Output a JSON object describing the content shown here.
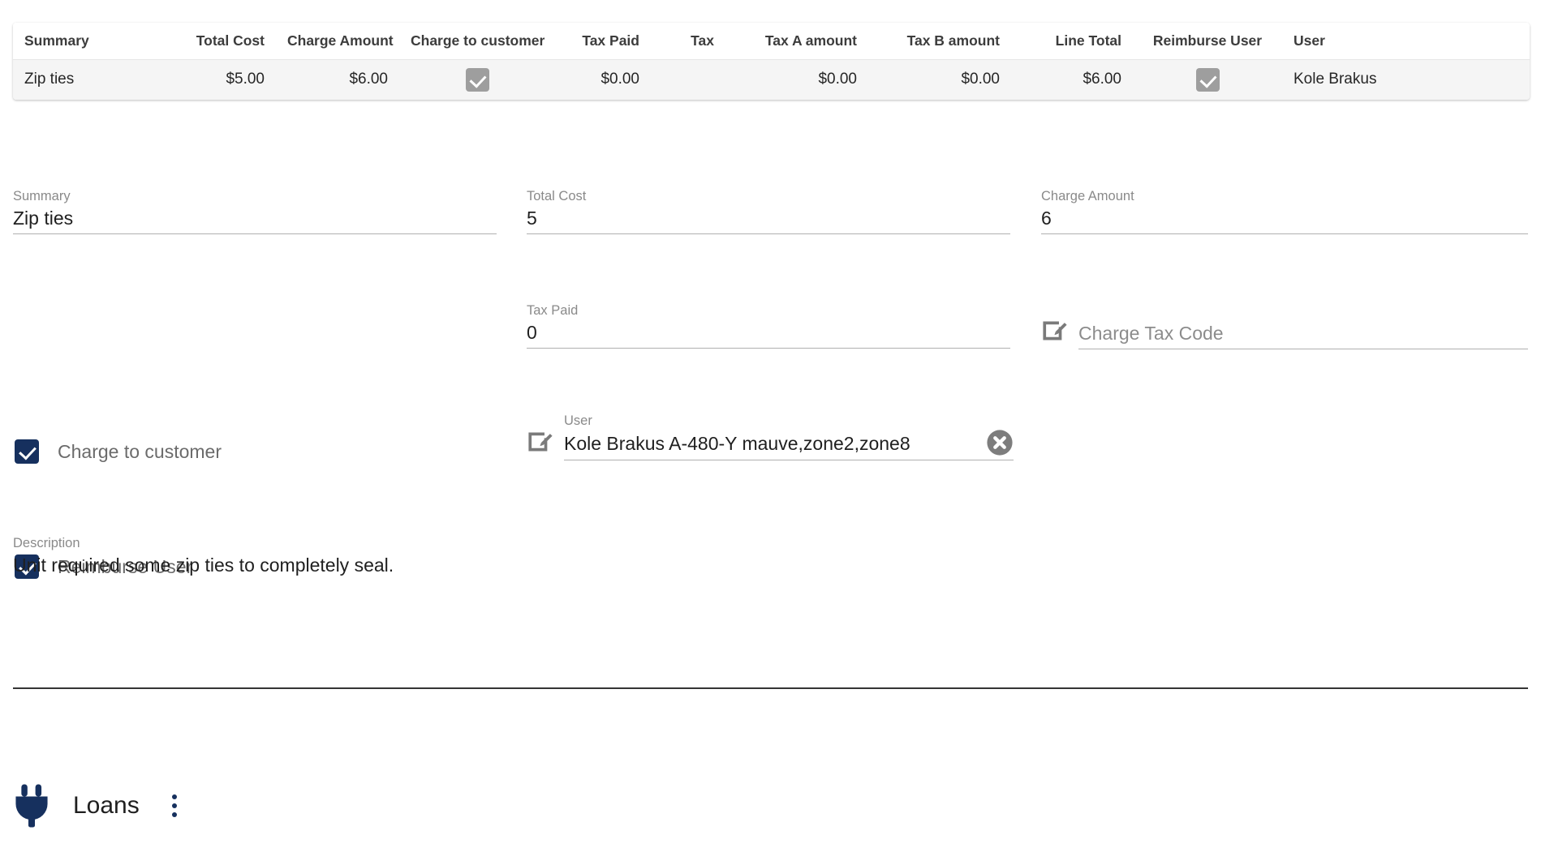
{
  "table": {
    "columns": [
      {
        "key": "summary",
        "label": "Summary",
        "align": "left"
      },
      {
        "key": "total_cost",
        "label": "Total Cost",
        "align": "right"
      },
      {
        "key": "charge_amount",
        "label": "Charge Amount",
        "align": "right"
      },
      {
        "key": "charge_to_customer",
        "label": "Charge to customer",
        "align": "center"
      },
      {
        "key": "tax_paid",
        "label": "Tax Paid",
        "align": "right"
      },
      {
        "key": "tax",
        "label": "Tax",
        "align": "right"
      },
      {
        "key": "tax_a_amount",
        "label": "Tax A amount",
        "align": "right"
      },
      {
        "key": "tax_b_amount",
        "label": "Tax B amount",
        "align": "right"
      },
      {
        "key": "line_total",
        "label": "Line Total",
        "align": "right"
      },
      {
        "key": "reimburse_user",
        "label": "Reimburse User",
        "align": "center"
      },
      {
        "key": "user",
        "label": "User",
        "align": "left"
      }
    ],
    "rows": [
      {
        "summary": "Zip ties",
        "total_cost": "$5.00",
        "charge_amount": "$6.00",
        "charge_to_customer": true,
        "tax_paid": "$0.00",
        "tax": "",
        "tax_a_amount": "$0.00",
        "tax_b_amount": "$0.00",
        "line_total": "$6.00",
        "reimburse_user": true,
        "user": "Kole Brakus"
      }
    ]
  },
  "form": {
    "summary": {
      "label": "Summary",
      "value": "Zip ties"
    },
    "total_cost": {
      "label": "Total Cost",
      "value": "5"
    },
    "charge_amount": {
      "label": "Charge Amount",
      "value": "6"
    },
    "charge_to_customer": {
      "label": "Charge to customer",
      "checked": true
    },
    "tax_paid": {
      "label": "Tax Paid",
      "value": "0"
    },
    "charge_tax_code": {
      "label": "",
      "value": "",
      "placeholder": "Charge Tax Code",
      "icon": "edit-icon"
    },
    "reimburse_user": {
      "label": "Reimburse User",
      "checked": true
    },
    "user": {
      "label": "User",
      "value": "Kole Brakus A-480-Y mauve,zone2,zone8",
      "icon": "edit-icon",
      "clear_icon": "clear-circle-icon"
    },
    "description": {
      "label": "Description",
      "value": "Unit required some zip ties to completely seal."
    }
  },
  "footer": {
    "section": {
      "icon": "plug-icon",
      "label": "Loans",
      "menu_icon": "kebab-menu-icon"
    }
  },
  "colors": {
    "accent_navy": "#16305e",
    "table_row_bg": "#f5f5f5",
    "checkbox_grey": "#9e9e9e",
    "label_grey": "#8a8a8a",
    "divider": "#353535"
  }
}
